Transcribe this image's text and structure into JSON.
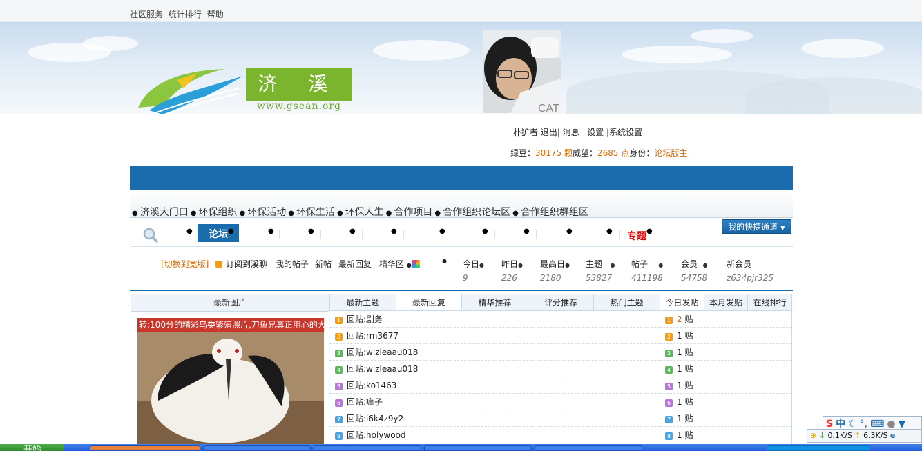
{
  "topbar": {
    "links": [
      "社区服务",
      "统计排行",
      "帮助"
    ]
  },
  "logo": {
    "name": "济 溪",
    "url": "www.gsean.org"
  },
  "user": {
    "name": "朴犷者",
    "actions": [
      "退出|",
      "消息",
      "设置",
      "|系统设置"
    ],
    "stats": {
      "beans_label": "绿豆：",
      "beans_value": "30175 颗",
      "prestige_label": "威望：",
      "prestige_value": "2685 点",
      "role_label": "身份：",
      "role_value": "论坛版主"
    }
  },
  "mainnav": {
    "items": [
      "济溪大门口",
      "环保组织",
      "环保活动",
      "环保生活",
      "环保人生",
      "合作项目",
      "合作组织论坛区",
      "合作组织群组区"
    ]
  },
  "subnav": {
    "active_tab": "论坛",
    "special": "专题",
    "quick_button": "我的快捷通道"
  },
  "toolbar": {
    "switch": "[切换到宽版]",
    "links": [
      "订阅到溪聊",
      "我的帖子",
      "新帖",
      "最新回复",
      "精华区"
    ]
  },
  "site_stats": [
    {
      "label": "今日",
      "value": "9"
    },
    {
      "label": "昨日",
      "value": "226"
    },
    {
      "label": "最高日",
      "value": "2180"
    },
    {
      "label": "主题",
      "value": "53827"
    },
    {
      "label": "帖子",
      "value": "411198"
    },
    {
      "label": "会员",
      "value": "54758"
    },
    {
      "label": "新会员",
      "value": "z634pjr325"
    }
  ],
  "left_panel": {
    "title": "最新图片",
    "caption": "转:100分的精彩鸟类繁殖照片,刀鱼兄真正用心的大作"
  },
  "mid_tabs": [
    "最新主题",
    "最新回复",
    "精华推荐",
    "评分推荐",
    "热门主题"
  ],
  "replies": [
    "回贴:剧务",
    "回贴:rm3677",
    "回贴:wizleaau018",
    "回贴:wizleaau018",
    "回贴:ko1463",
    "回贴:瘋子",
    "回贴:i6k4z9y2",
    "回贴:holywood"
  ],
  "right_tabs": [
    "今日发贴",
    "本月发贴",
    "在线排行"
  ],
  "today_posts": [
    {
      "count": "2",
      "unit": "贴"
    },
    {
      "count": "1",
      "unit": "贴"
    },
    {
      "count": "1",
      "unit": "贴"
    },
    {
      "count": "1",
      "unit": "贴"
    },
    {
      "count": "1",
      "unit": "贴"
    },
    {
      "count": "1",
      "unit": "贴"
    },
    {
      "count": "1",
      "unit": "贴"
    },
    {
      "count": "1",
      "unit": "贴"
    }
  ],
  "rank_colors": [
    "#f39c12",
    "#f39c12",
    "#5cb85c",
    "#5cb85c",
    "#b678d6",
    "#b678d6",
    "#4aa3df",
    "#4aa3df"
  ],
  "tray": {
    "ime_mode": "中",
    "down_speed": "0.1K/S",
    "up_speed": "6.3K/S"
  },
  "taskbar": {
    "start_label": "开始"
  }
}
